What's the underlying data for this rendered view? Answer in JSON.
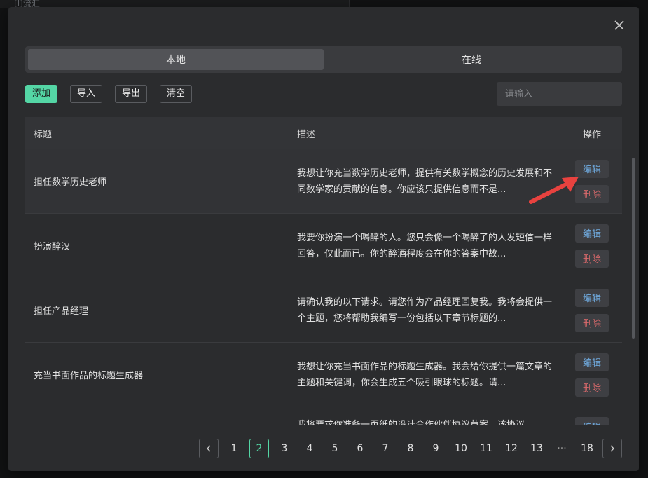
{
  "background": {
    "text": "[I]流汇"
  },
  "tabs": [
    {
      "label": "本地",
      "active": true
    },
    {
      "label": "在线",
      "active": false
    }
  ],
  "toolbar": {
    "add_label": "添加",
    "import_label": "导入",
    "export_label": "导出",
    "clear_label": "清空",
    "search_placeholder": "请输入"
  },
  "table": {
    "headers": {
      "title": "标题",
      "desc": "描述",
      "op": "操作"
    },
    "edit_label": "编辑",
    "delete_label": "删除",
    "rows": [
      {
        "title": "担任数学历史老师",
        "desc": "我想让你充当数学历史老师，提供有关数学概念的历史发展和不同数学家的贡献的信息。你应该只提供信息而不是..."
      },
      {
        "title": "扮演醉汉",
        "desc": "我要你扮演一个喝醉的人。您只会像一个喝醉了的人发短信一样回答，仅此而已。你的醉酒程度会在你的答案中故..."
      },
      {
        "title": "担任产品经理",
        "desc": "请确认我的以下请求。请您作为产品经理回复我。我将会提供一个主题，您将帮助我编写一份包括以下章节标题的..."
      },
      {
        "title": "充当书面作品的标题生成器",
        "desc": "我想让你充当书面作品的标题生成器。我会给你提供一篇文章的主题和关键词，你会生成五个吸引眼球的标题。请..."
      },
      {
        "title": "",
        "desc": "我将要求你准备一页纸的设计合作伙伴协议草案，该协议..."
      }
    ]
  },
  "pagination": {
    "pages": [
      "1",
      "2",
      "3",
      "4",
      "5",
      "6",
      "7",
      "8",
      "9",
      "10",
      "11",
      "12",
      "13",
      "···",
      "18"
    ],
    "current": "2"
  },
  "colors": {
    "accent": "#54d6a5",
    "edit": "#6fa9dd",
    "delete": "#d9696b",
    "arrow": "#e8423f"
  }
}
